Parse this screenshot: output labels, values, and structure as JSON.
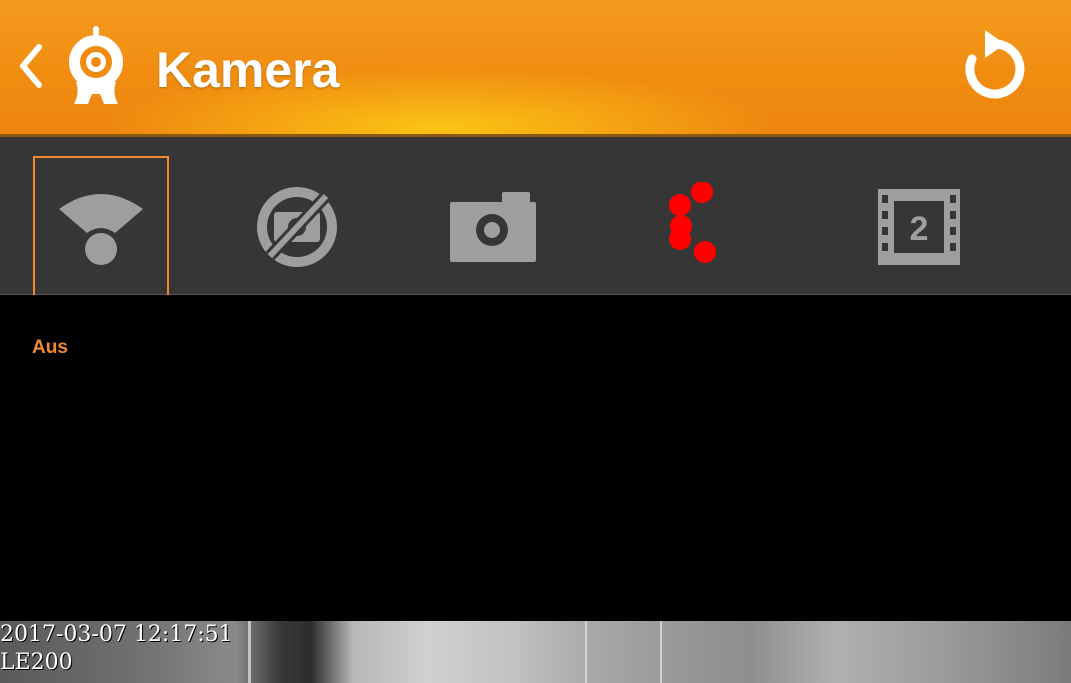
{
  "header": {
    "title": "Kamera",
    "back_icon": "chevron-left-icon",
    "logo_icon": "webcam-icon",
    "refresh_icon": "refresh-icon",
    "background": "#f08c10",
    "accent": "#f08a30"
  },
  "toolbar": {
    "items": [
      {
        "name": "wifi-signal-icon",
        "selected": true
      },
      {
        "name": "no-image-icon",
        "selected": false
      },
      {
        "name": "camera-icon",
        "selected": false
      },
      {
        "name": "loading-icon",
        "selected": false
      },
      {
        "name": "film-stream-icon",
        "badge": "2",
        "selected": false
      }
    ]
  },
  "main": {
    "status": "Aus"
  },
  "feed": {
    "timestamp": "2017-03-07 12:17:51",
    "device": "LE200"
  }
}
